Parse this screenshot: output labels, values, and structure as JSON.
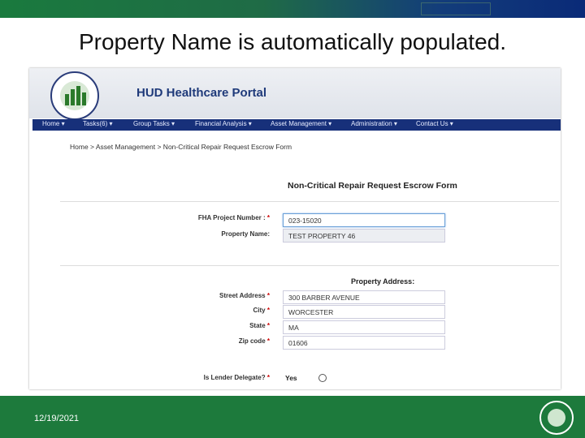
{
  "slide": {
    "title": "Property Name is automatically populated.",
    "date": "12/19/2021"
  },
  "portal": {
    "title": "HUD Healthcare Portal",
    "nav": [
      "Home ▾",
      "Tasks(6) ▾",
      "Group Tasks ▾",
      "Financial Analysis ▾",
      "Asset Management ▾",
      "Administration ▾",
      "Contact Us ▾"
    ],
    "breadcrumb": "Home > Asset Management > Non-Critical Repair Request Escrow Form"
  },
  "form": {
    "title": "Non-Critical Repair Request Escrow Form",
    "fha_label": "FHA Project Number :",
    "fha_value": "023-15020",
    "property_label": "Property Name:",
    "property_value": "TEST PROPERTY 46",
    "address_title": "Property Address:",
    "street_label": "Street Address",
    "street_value": "300 BARBER AVENUE",
    "city_label": "City",
    "city_value": "WORCESTER",
    "state_label": "State",
    "state_value": "MA",
    "zip_label": "Zip code",
    "zip_value": "01606",
    "lender_label": "Is Lender Delegate?",
    "yes_label": "Yes",
    "required_mark": "*"
  },
  "icons": {
    "header_seal": "hud-seal-icon",
    "footer_seal": "hud-seal-icon",
    "radio": "radio-button-icon"
  },
  "colors": {
    "top_bar_start": "#1a7a3e",
    "top_bar_end": "#0a2a78",
    "nav_bar": "#17307a",
    "portal_title": "#1f3a7a",
    "footer": "#1d7a3c",
    "required": "#cc0000"
  }
}
